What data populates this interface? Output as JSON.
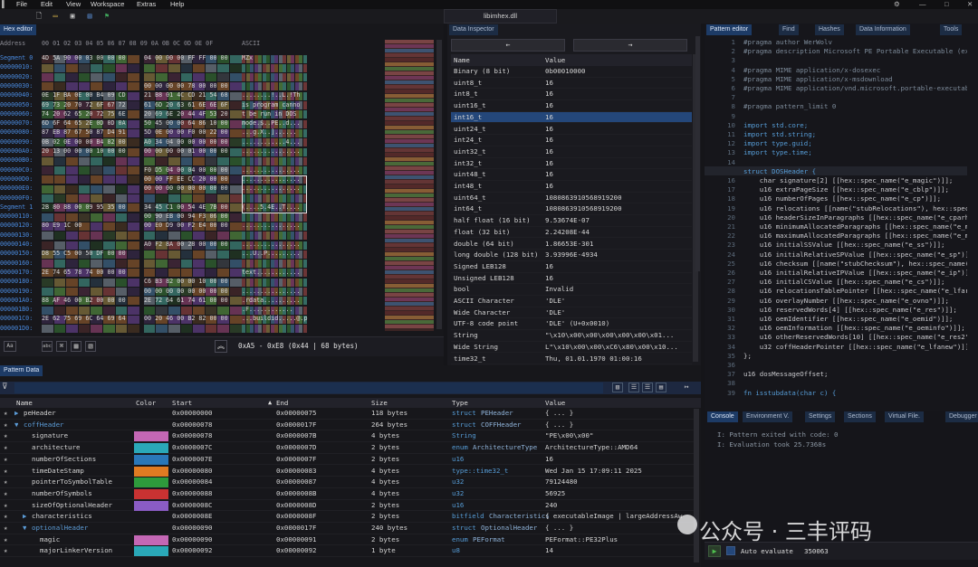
{
  "menu": {
    "items": [
      "File",
      "Edit",
      "View",
      "Workspace",
      "Extras",
      "Help"
    ],
    "file_title": "libimhex.dll"
  },
  "hex_editor": {
    "tab": "Hex editor",
    "address_label": "Address",
    "columns": "00 01 02 03 04 05 06 07  08 09 0A 0B 0C 0D 0E 0F",
    "ascii_label": "ASCII",
    "addresses": [
      "Segment 0",
      "00000010:",
      "00000020:",
      "00000030:",
      "00000040:",
      "00000050:",
      "00000060:",
      "00000070:",
      "00000080:",
      "00000090:",
      "000000A0:",
      "000000B0:",
      "000000C0:",
      "000000D0:",
      "000000E0:",
      "000000F0:",
      "Segment 1",
      "00000110:",
      "00000120:",
      "00000130:",
      "00000140:",
      "00000150:",
      "00000160:",
      "00000170:",
      "00000180:",
      "00000190:",
      "000001A0:",
      "000001B0:",
      "000001C0:",
      "000001D0:"
    ],
    "hex_left": [
      "4D 5A 90 00 03 00 00 00",
      "",
      "",
      "",
      "0E 1F BA 0E 00 B4 09 CD",
      "69 73 20 70 72 6F 67 72",
      "74 20 62 65 20 72 75 6E",
      "6D 6F 64 65 2E 0D 0D 0A",
      "87 EB 87 67 50 87 D4 91",
      "0B 02 0E 00 00 B4 82 00",
      "20 13 00 00 00 10 00 00",
      "",
      "",
      "",
      "",
      "",
      "2B 80 88 00 09 95 35 00",
      "",
      "80 E9 1C 00",
      "",
      "",
      "D8 55 C5 00 50 DF 00 00",
      "",
      "2E 74 65 78 74 00 00 00",
      "",
      "",
      "88 AF 46 00 B2 00 00 00",
      "",
      "2E 62 75 69 6C 64 69 64",
      ""
    ],
    "hex_right": [
      "04 00 00 00 FF FF 00 00",
      "",
      "",
      "00 00 00 00 78 00 00 00",
      "21 B8 01 4C CD 21 54 68",
      "61 6D 20 63 61 6E 6E 6F",
      "20 69 6E 20 44 4F 53 20",
      "50 45 00 00 64 86 10 00",
      "5D 0E 00 00 F0 00 22 00",
      "A0 34 04 00 00 00 00 00",
      "00 00 00 00 01 00 00 00",
      "",
      "F0 D5 04 00 04 00 00 00",
      "00 00 FF EE CC 20 00 00",
      "00 00 00 00 00 00 00 00",
      "",
      "34 45 C1 00 54 4E 7B 00",
      "00 90 EB 00 94 F3 06 00",
      "00 E0 D9 00 F2 E4 00 00",
      "",
      "A0 F2 8A 00 28 00 00 00",
      "",
      "",
      "",
      "C6 B3 82 00 00 10 00 00",
      "00 00 00 00 00 00 00 00",
      "2E 72 64 61 74 61 00 00",
      "",
      "00 20 46 00 B2 82 00 00",
      ""
    ],
    "ascii": [
      "MZx",
      "",
      "",
      "",
      "........!..L.!Th",
      "is program canno",
      "t be run in DOS ",
      "mode.$..PE..d...",
      "...g.X..]......",
      "............4...",
      "................",
      "",
      "................",
      "................",
      "................",
      "",
      "(....5.4E..T....",
      "",
      "................",
      "",
      "................",
      "...U..P.........",
      "",
      "text............",
      "",
      "................",
      ".rdata..........",
      ".F............",
      "...buildid.....@.p",
      ""
    ],
    "status": "0xA5 - 0xE8 (0x44 | 68 bytes)"
  },
  "data_inspector": {
    "tab": "Data Inspector",
    "col_name": "Name",
    "col_value": "Value",
    "rows": [
      [
        "Binary (8 bit)",
        "0b00010000"
      ],
      [
        "uint8_t",
        "16"
      ],
      [
        "int8_t",
        "16"
      ],
      [
        "uint16_t",
        "16"
      ],
      [
        "int16_t",
        "16"
      ],
      [
        "uint24_t",
        "16"
      ],
      [
        "int24_t",
        "16"
      ],
      [
        "uint32_t",
        "16"
      ],
      [
        "int32_t",
        "16"
      ],
      [
        "uint48_t",
        "16"
      ],
      [
        "int48_t",
        "16"
      ],
      [
        "uint64_t",
        "1080863910568919200"
      ],
      [
        "int64_t",
        "1080863910568919200"
      ],
      [
        "half float (16 bit)",
        "9.53674E-07"
      ],
      [
        "float (32 bit)",
        "2.24208E-44"
      ],
      [
        "double (64 bit)",
        "1.86653E-301"
      ],
      [
        "long double (128 bit)",
        "3.93996E-4934"
      ],
      [
        "Signed LEB128",
        "16"
      ],
      [
        "Unsigned LEB128",
        "16"
      ],
      [
        "bool",
        "Invalid"
      ],
      [
        "ASCII Character",
        "'DLE'"
      ],
      [
        "Wide Character",
        "'DLE'"
      ],
      [
        "UTF-8 code point",
        "'DLE' (U+0x0010)"
      ],
      [
        "String",
        "\"\\x10\\x00\\x00\\x00\\x00\\x00\\x01..."
      ],
      [
        "Wide String",
        "L\"\\x10\\x00\\x00\\xC6\\x80\\x00\\x10..."
      ],
      [
        "time32_t",
        "Thu, 01.01.1970 01:00:16"
      ]
    ]
  },
  "pattern_editor": {
    "tabs": [
      "Pattern editor",
      "Find",
      "Hashes",
      "Data Information",
      "Tools"
    ],
    "lines": [
      [
        "1",
        "#pragma author WerWolv",
        "cm"
      ],
      [
        "2",
        "#pragma description Microsoft PE Portable Executable (exe/",
        "cm"
      ],
      [
        "3",
        "",
        ""
      ],
      [
        "4",
        "#pragma MIME application/x-dosexec",
        "cm"
      ],
      [
        "5",
        "#pragma MIME application/x-msdownload",
        "cm"
      ],
      [
        "6",
        "#pragma MIME application/vnd.microsoft.portable-executable",
        "cm"
      ],
      [
        "7",
        "",
        ""
      ],
      [
        "8",
        "#pragma pattern_limit 0",
        "cm"
      ],
      [
        "9",
        "",
        ""
      ],
      [
        "10",
        "import std.core;",
        "kw"
      ],
      [
        "11",
        "import std.string;",
        "kw"
      ],
      [
        "12",
        "import type.guid;",
        "kw"
      ],
      [
        "13",
        "import type.time;",
        "kw"
      ],
      [
        "14",
        "",
        ""
      ],
      [
        "15",
        "struct DOSHeader {",
        "kw"
      ],
      [
        "16",
        "    char signature[2] [[hex::spec_name(\"e_magic\")]];",
        "str"
      ],
      [
        "17",
        "    u16 extraPageSize [[hex::spec_name(\"e_cblp\")]];",
        "str"
      ],
      [
        "18",
        "    u16 numberOfPages [[hex::spec_name(\"e_cp\")]];",
        "str"
      ],
      [
        "19",
        "    u16 relocations [[name(\"stubRelocations\"), hex::spec_n",
        "str"
      ],
      [
        "20",
        "    u16 headerSizeInParagraphs [[hex::spec_name(\"e_cparhdr",
        "str"
      ],
      [
        "21",
        "    u16 minimumAllocatedParagraphs [[hex::spec_name(\"e_min",
        "str"
      ],
      [
        "22",
        "    u16 maximumAllocatedParagraphs [[hex::spec_name(\"e_max",
        "str"
      ],
      [
        "23",
        "    u16 initialSSValue [[hex::spec_name(\"e_ss\")]];",
        "str"
      ],
      [
        "24",
        "    u16 initialRelativeSPValue [[hex::spec_name(\"e_sp\")]];",
        "str"
      ],
      [
        "25",
        "    u16 checksum [[name(\"stubChecksum\"), hex::spec_name(\"e",
        "str"
      ],
      [
        "26",
        "    u16 initialRelativeIPValue [[hex::spec_name(\"e_ip\")]];",
        "str"
      ],
      [
        "27",
        "    u16 initialCSValue [[hex::spec_name(\"e_cs\")]];",
        "str"
      ],
      [
        "28",
        "    u16 relocationsTablePointer [[hex::spec_name(\"e_lfarlc",
        "str"
      ],
      [
        "29",
        "    u16 overlayNumber [[hex::spec_name(\"e_ovno\")]];",
        "str"
      ],
      [
        "30",
        "    u16 reservedWords[4] [[hex::spec_name(\"e_res\")]];",
        "str"
      ],
      [
        "31",
        "    u16 oemIdentifier [[hex::spec_name(\"e_oemid\")]];",
        "str"
      ],
      [
        "32",
        "    u16 oemInformation [[hex::spec_name(\"e_oeminfo\")]];",
        "str"
      ],
      [
        "33",
        "    u16 otherReservedWords[10] [[hex::spec_name(\"e_res2\")]",
        "str"
      ],
      [
        "34",
        "    u32 coffHeaderPointer [[hex::spec_name(\"e_lfanew\")]];",
        "str"
      ],
      [
        "35",
        "};",
        "str"
      ],
      [
        "36",
        "",
        ""
      ],
      [
        "37",
        "u16 dosMessageOffset;",
        "str"
      ],
      [
        "38",
        "",
        ""
      ],
      [
        "39",
        "fn isstubdata(char c) {",
        "kw"
      ]
    ]
  },
  "console": {
    "tabs": [
      "Console",
      "Environment V.",
      "Settings",
      "Sections",
      "Virtual File.",
      "Debugger"
    ],
    "lines": [
      "I: Pattern exited with code: 0",
      "I: Evaluation took 25.7368s"
    ],
    "auto_evaluate": "Auto evaluate",
    "count": "350063"
  },
  "pattern_data": {
    "tab": "Pattern Data",
    "headers": [
      "Name",
      "Color",
      "Start",
      "End",
      "Size",
      "Type",
      "Value"
    ],
    "rows": [
      {
        "name": "peHeader",
        "indent": 0,
        "expand": "▶",
        "start": "0x00000000",
        "end": "0x00000075",
        "size": "118 bytes",
        "type_kw": "struct",
        "type": "PEHeader",
        "value": "{ ... }",
        "color": ""
      },
      {
        "name": "coffHeader",
        "indent": 0,
        "expand": "▼",
        "start": "0x00000078",
        "end": "0x0000017F",
        "size": "264 bytes",
        "type_kw": "struct",
        "type": "COFFHeader",
        "value": "{ ... }",
        "color": ""
      },
      {
        "name": "signature",
        "indent": 1,
        "expand": "",
        "start": "0x00000078",
        "end": "0x0000007B",
        "size": "4 bytes",
        "type_kw": "",
        "type": "String",
        "value": "\"PE\\x00\\x00\"",
        "color": "#c467b5"
      },
      {
        "name": "architecture",
        "indent": 1,
        "expand": "",
        "start": "0x0000007C",
        "end": "0x0000007D",
        "size": "2 bytes",
        "type_kw": "enum",
        "type": "ArchitectureType",
        "value": "ArchitectureType::AMD64",
        "color": "#2aa8b8"
      },
      {
        "name": "numberOfSections",
        "indent": 1,
        "expand": "",
        "start": "0x0000007E",
        "end": "0x0000007F",
        "size": "2 bytes",
        "type_kw": "",
        "type": "u16",
        "value": "16",
        "color": "#2a77b8"
      },
      {
        "name": "timeDateStamp",
        "indent": 1,
        "expand": "",
        "start": "0x00000080",
        "end": "0x00000083",
        "size": "4 bytes",
        "type_kw": "",
        "type": "type::time32_t",
        "value": "Wed Jan 15 17:09:11 2025",
        "color": "#e07b22"
      },
      {
        "name": "pointerToSymbolTable",
        "indent": 1,
        "expand": "",
        "start": "0x00000084",
        "end": "0x00000087",
        "size": "4 bytes",
        "type_kw": "",
        "type": "u32",
        "value": "79124480",
        "color": "#2e9b3c"
      },
      {
        "name": "numberOfSymbols",
        "indent": 1,
        "expand": "",
        "start": "0x00000088",
        "end": "0x0000008B",
        "size": "4 bytes",
        "type_kw": "",
        "type": "u32",
        "value": "56925",
        "color": "#c83232"
      },
      {
        "name": "sizeOfOptionalHeader",
        "indent": 1,
        "expand": "",
        "start": "0x0000008C",
        "end": "0x0000008D",
        "size": "2 bytes",
        "type_kw": "",
        "type": "u16",
        "value": "240",
        "color": "#8a5cc4"
      },
      {
        "name": "characteristics",
        "indent": 1,
        "expand": "▶",
        "start": "0x0000008E",
        "end": "0x0000008F",
        "size": "2 bytes",
        "type_kw": "bitfield",
        "type": "Characteristics",
        "value": "{ executableImage | largeAddressAw",
        "color": ""
      },
      {
        "name": "optionalHeader",
        "indent": 1,
        "expand": "▼",
        "start": "0x00000090",
        "end": "0x0000017F",
        "size": "240 bytes",
        "type_kw": "struct",
        "type": "OptionalHeader",
        "value": "{ ... }",
        "color": ""
      },
      {
        "name": "magic",
        "indent": 2,
        "expand": "",
        "start": "0x00000090",
        "end": "0x00000091",
        "size": "2 bytes",
        "type_kw": "enum",
        "type": "PEFormat",
        "value": "PEFormat::PE32Plus",
        "color": "#c467b5"
      },
      {
        "name": "majorLinkerVersion",
        "indent": 2,
        "expand": "",
        "start": "0x00000092",
        "end": "0x00000092",
        "size": "1 byte",
        "type_kw": "",
        "type": "u8",
        "value": "14",
        "color": "#2aa8b8"
      }
    ]
  },
  "watermark": "公众号 · 三丰评码",
  "colors": {
    "accent": "#1d3b66",
    "selection": "#24477a",
    "keyword": "#569cd6"
  }
}
